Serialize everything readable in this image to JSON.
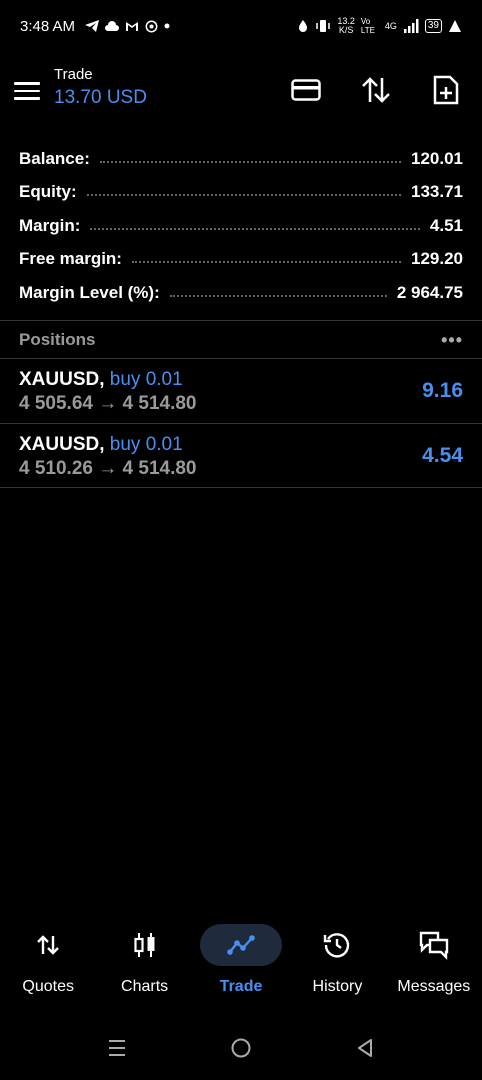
{
  "status_bar": {
    "time": "3:48 AM",
    "speed_value": "13.2",
    "speed_unit": "K/S",
    "volte": "Vo LTE",
    "network": "4G",
    "battery": "39"
  },
  "header": {
    "title": "Trade",
    "balance_display": "13.70 USD"
  },
  "summary": [
    {
      "label": "Balance:",
      "value": "120.01"
    },
    {
      "label": "Equity:",
      "value": "133.71"
    },
    {
      "label": "Margin:",
      "value": "4.51"
    },
    {
      "label": "Free margin:",
      "value": "129.20"
    },
    {
      "label": "Margin Level (%):",
      "value": "2 964.75"
    }
  ],
  "positions": {
    "title": "Positions",
    "items": [
      {
        "symbol": "XAUUSD,",
        "side": "buy 0.01",
        "open_price": "4 505.64",
        "arrow": "→",
        "current_price": "4 514.80",
        "profit": "9.16"
      },
      {
        "symbol": "XAUUSD,",
        "side": "buy 0.01",
        "open_price": "4 510.26",
        "arrow": "→",
        "current_price": "4 514.80",
        "profit": "4.54"
      }
    ]
  },
  "bottom_nav": [
    {
      "label": "Quotes",
      "icon": "quotes-icon"
    },
    {
      "label": "Charts",
      "icon": "charts-icon"
    },
    {
      "label": "Trade",
      "icon": "trade-icon",
      "active": true
    },
    {
      "label": "History",
      "icon": "history-icon"
    },
    {
      "label": "Messages",
      "icon": "messages-icon"
    }
  ],
  "colors": {
    "accent": "#4a8ff0",
    "background": "#000000",
    "muted": "#9a9a9a"
  }
}
